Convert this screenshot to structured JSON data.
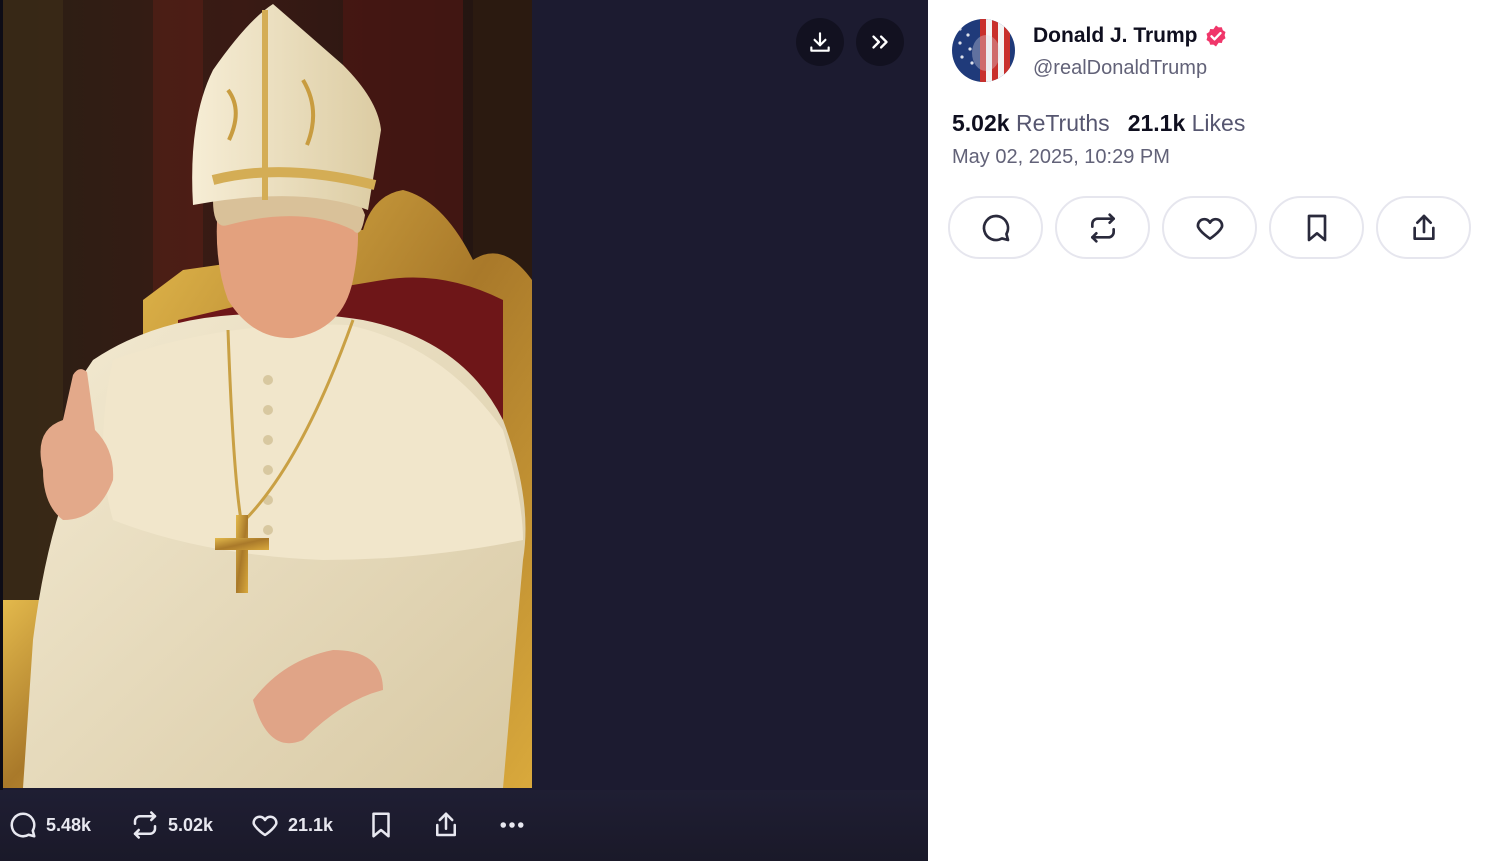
{
  "post": {
    "author_name": "Donald J. Trump",
    "handle": "@realDonaldTrump",
    "retruths_count": "5.02k",
    "retruths_label": "ReTruths",
    "likes_count": "21.1k",
    "likes_label": "Likes",
    "timestamp": "May 02, 2025, 10:29 PM"
  },
  "viewer_bar": {
    "replies": "5.48k",
    "retruths": "5.02k",
    "likes": "21.1k"
  },
  "icons": {
    "top": [
      "download-icon",
      "chevrons-right-icon"
    ],
    "bottom": [
      "reply-icon",
      "retruth-icon",
      "heart-icon",
      "bookmark-icon",
      "share-icon",
      "more-icon"
    ],
    "actions": [
      "reply-icon",
      "retruth-icon",
      "heart-icon",
      "bookmark-icon",
      "share-icon"
    ]
  },
  "colors": {
    "viewer_bg": "#1c1b30",
    "verified": "#f0366a",
    "text_primary": "#0f0f1f",
    "text_secondary": "#626278",
    "button_border": "#e6e6ee"
  }
}
